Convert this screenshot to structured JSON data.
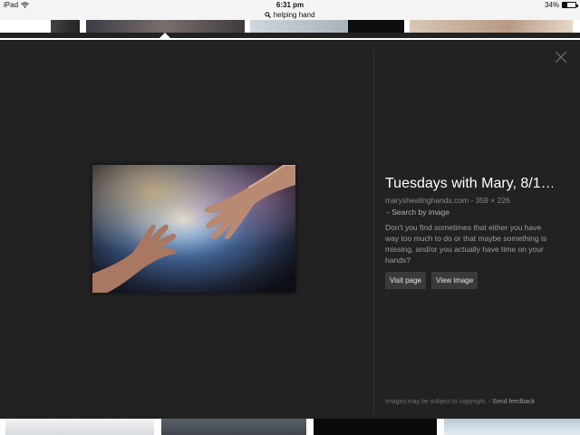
{
  "status_bar": {
    "device": "iPad",
    "time": "6:31 pm",
    "battery": "34%",
    "battery_level": 0.34
  },
  "search": {
    "query": "helping hand"
  },
  "detail": {
    "title": "Tuesdays with Mary, 8/1…",
    "domain": "maryshealinghands.com",
    "dimensions": "359 × 226",
    "search_by_image": "Search by image",
    "description": "Don't you find sometimes that either you have way too much to do or that maybe something is missing, and/or you actually have time on your hands?",
    "visit_page": "Visit page",
    "view_image": "View image"
  },
  "footer": {
    "copyright": "Images may be subject to copyright.",
    "send_feedback": "Send feedback"
  },
  "icons": {
    "wifi": "wifi-icon",
    "search": "search-icon",
    "close": "close-icon",
    "battery": "battery-icon"
  }
}
